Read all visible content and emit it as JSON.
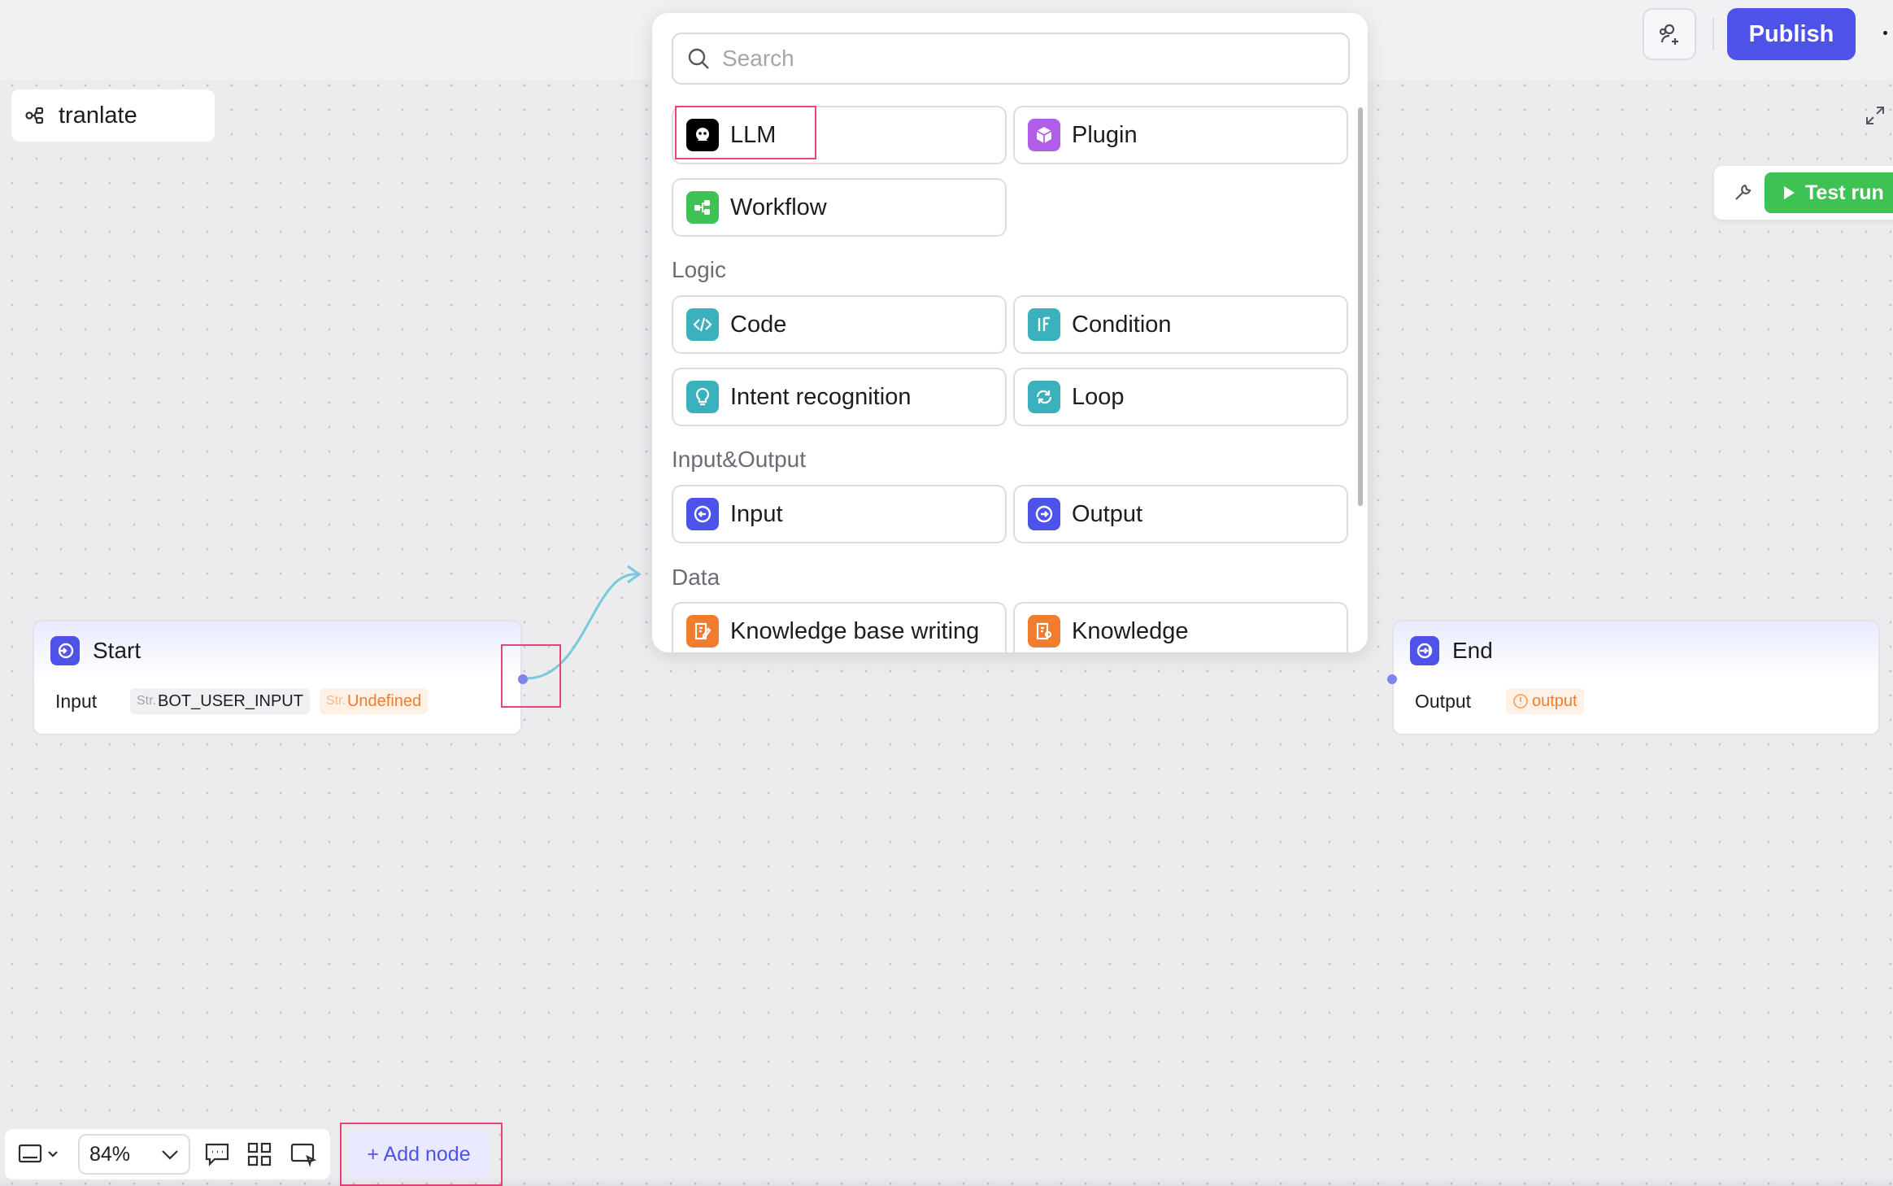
{
  "topbar": {
    "publish_label": "Publish",
    "icons": [
      "add-collaborator-icon",
      "more-icon"
    ]
  },
  "workflow": {
    "title": "tranlate"
  },
  "test_run": {
    "label": "Test run"
  },
  "picker": {
    "search_placeholder": "Search",
    "top_items": [
      {
        "label": "LLM",
        "icon": "llm-icon",
        "color": "#000000"
      },
      {
        "label": "Plugin",
        "icon": "plugin-icon",
        "color": "#b05ee8"
      },
      {
        "label": "Workflow",
        "icon": "workflow-icon",
        "color": "#3ec254"
      }
    ],
    "sections": [
      {
        "title": "Logic",
        "items": [
          {
            "label": "Code",
            "icon": "code-icon",
            "color": "#3cb1be"
          },
          {
            "label": "Condition",
            "icon": "condition-icon",
            "color": "#3cb1be"
          },
          {
            "label": "Intent recognition",
            "icon": "intent-icon",
            "color": "#3cb1be"
          },
          {
            "label": "Loop",
            "icon": "loop-icon",
            "color": "#3cb1be"
          }
        ]
      },
      {
        "title": "Input&Output",
        "items": [
          {
            "label": "Input",
            "icon": "input-icon",
            "color": "#4d53e8"
          },
          {
            "label": "Output",
            "icon": "output-icon",
            "color": "#4d53e8"
          }
        ]
      },
      {
        "title": "Data",
        "items": [
          {
            "label": "Knowledge base writing",
            "icon": "knowledge-write-icon",
            "color": "#f07c2e"
          },
          {
            "label": "Knowledge",
            "icon": "knowledge-icon",
            "color": "#f07c2e"
          }
        ]
      }
    ]
  },
  "nodes": {
    "start": {
      "title": "Start",
      "row_label": "Input",
      "var_prefix": "Str.",
      "var_name": "BOT_USER_INPUT",
      "type_prefix": "Str.",
      "type_value": "Undefined"
    },
    "end": {
      "title": "End",
      "row_label": "Output",
      "warn_value": "output"
    }
  },
  "toolbar": {
    "zoom": "84%",
    "add_node_label": "+ Add node"
  },
  "colors": {
    "brand": "#4d53e8",
    "success": "#3ec254",
    "warning": "#f07c2e",
    "highlight": "#e8467a"
  }
}
